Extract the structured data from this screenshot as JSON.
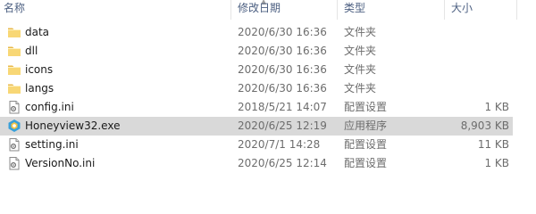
{
  "columns": {
    "name": "名称",
    "date": "修改日期",
    "type": "类型",
    "size": "大小"
  },
  "files": [
    {
      "name": "data",
      "date": "2020/6/30 16:36",
      "type": "文件夹",
      "size": "",
      "icon": "folder-icon"
    },
    {
      "name": "dll",
      "date": "2020/6/30 16:36",
      "type": "文件夹",
      "size": "",
      "icon": "folder-icon"
    },
    {
      "name": "icons",
      "date": "2020/6/30 16:36",
      "type": "文件夹",
      "size": "",
      "icon": "folder-icon"
    },
    {
      "name": "langs",
      "date": "2020/6/30 16:36",
      "type": "文件夹",
      "size": "",
      "icon": "folder-icon"
    },
    {
      "name": "config.ini",
      "date": "2018/5/21 14:07",
      "type": "配置设置",
      "size": "1 KB",
      "icon": "settings-file-icon"
    },
    {
      "name": "Honeyview32.exe",
      "date": "2020/6/25 12:19",
      "type": "应用程序",
      "size": "8,903 KB",
      "icon": "honeyview-app-icon",
      "selected": true
    },
    {
      "name": "setting.ini",
      "date": "2020/7/1 14:28",
      "type": "配置设置",
      "size": "11 KB",
      "icon": "settings-file-icon"
    },
    {
      "name": "VersionNo.ini",
      "date": "2020/6/25 12:14",
      "type": "配置设置",
      "size": "1 KB",
      "icon": "settings-file-icon"
    }
  ],
  "colors": {
    "header_text": "#4d6082",
    "selected_row": "#d9d9d9",
    "folder": "#f8d775"
  }
}
